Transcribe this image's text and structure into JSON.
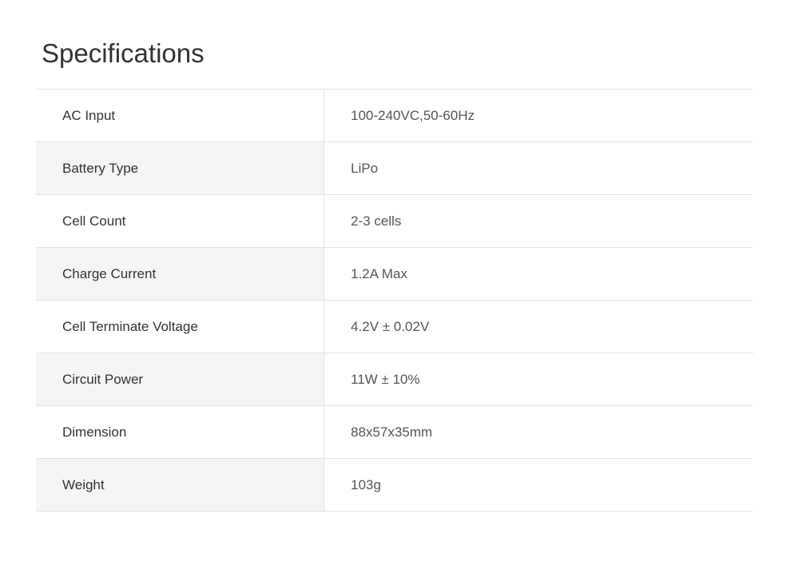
{
  "page": {
    "title": "Specifications"
  },
  "specs": [
    {
      "label": "AC Input",
      "value": "100-240VC,50-60Hz"
    },
    {
      "label": "Battery Type",
      "value": "LiPo"
    },
    {
      "label": "Cell Count",
      "value": "2-3 cells"
    },
    {
      "label": "Charge Current",
      "value": "1.2A Max"
    },
    {
      "label": "Cell Terminate Voltage",
      "value": "4.2V ± 0.02V"
    },
    {
      "label": "Circuit Power",
      "value": "11W ± 10%"
    },
    {
      "label": "Dimension",
      "value": "88x57x35mm"
    },
    {
      "label": "Weight",
      "value": "103g"
    }
  ],
  "colors": {
    "text": "#333333",
    "value_text": "#555555",
    "border": "#e3e3e3",
    "stripe": "#f5f5f5"
  }
}
